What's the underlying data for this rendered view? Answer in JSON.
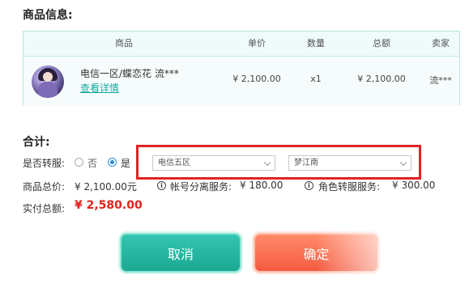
{
  "product_info": {
    "title": "商品信息:",
    "columns": [
      "商品",
      "单价",
      "数量",
      "总额",
      "卖家"
    ],
    "row": {
      "name": "电信一区/蝶恋花 流***",
      "link": "查看详情",
      "unit_price": "¥ 2,100.00",
      "quantity": "x1",
      "total": "¥ 2,100.00",
      "seller": "流***"
    }
  },
  "summary": {
    "title": "合计:",
    "transfer_label": "是否转服:",
    "option_no": "否",
    "option_yes": "是",
    "selected": "是",
    "server_select": "电信五区",
    "role_select": "梦江南",
    "goods_total_label": "商品总价:",
    "goods_total_value": "¥ 2,100.00元",
    "account_sep_label": "帐号分离服务:",
    "account_sep_value": "¥ 180.00",
    "role_transfer_label": "角色转服服务:",
    "role_transfer_value": "¥ 300.00",
    "paid_label": "实付总额:",
    "paid_value": "¥ 2,580.00",
    "info_glyph": "i"
  },
  "buttons": {
    "cancel": "取消",
    "confirm": "确定"
  },
  "colors": {
    "accent": "#1aaa9e",
    "highlight": "#e02424",
    "price": "#e0231d",
    "cancel_bg": "#1aa893",
    "confirm_bg": "#f45b3f"
  }
}
